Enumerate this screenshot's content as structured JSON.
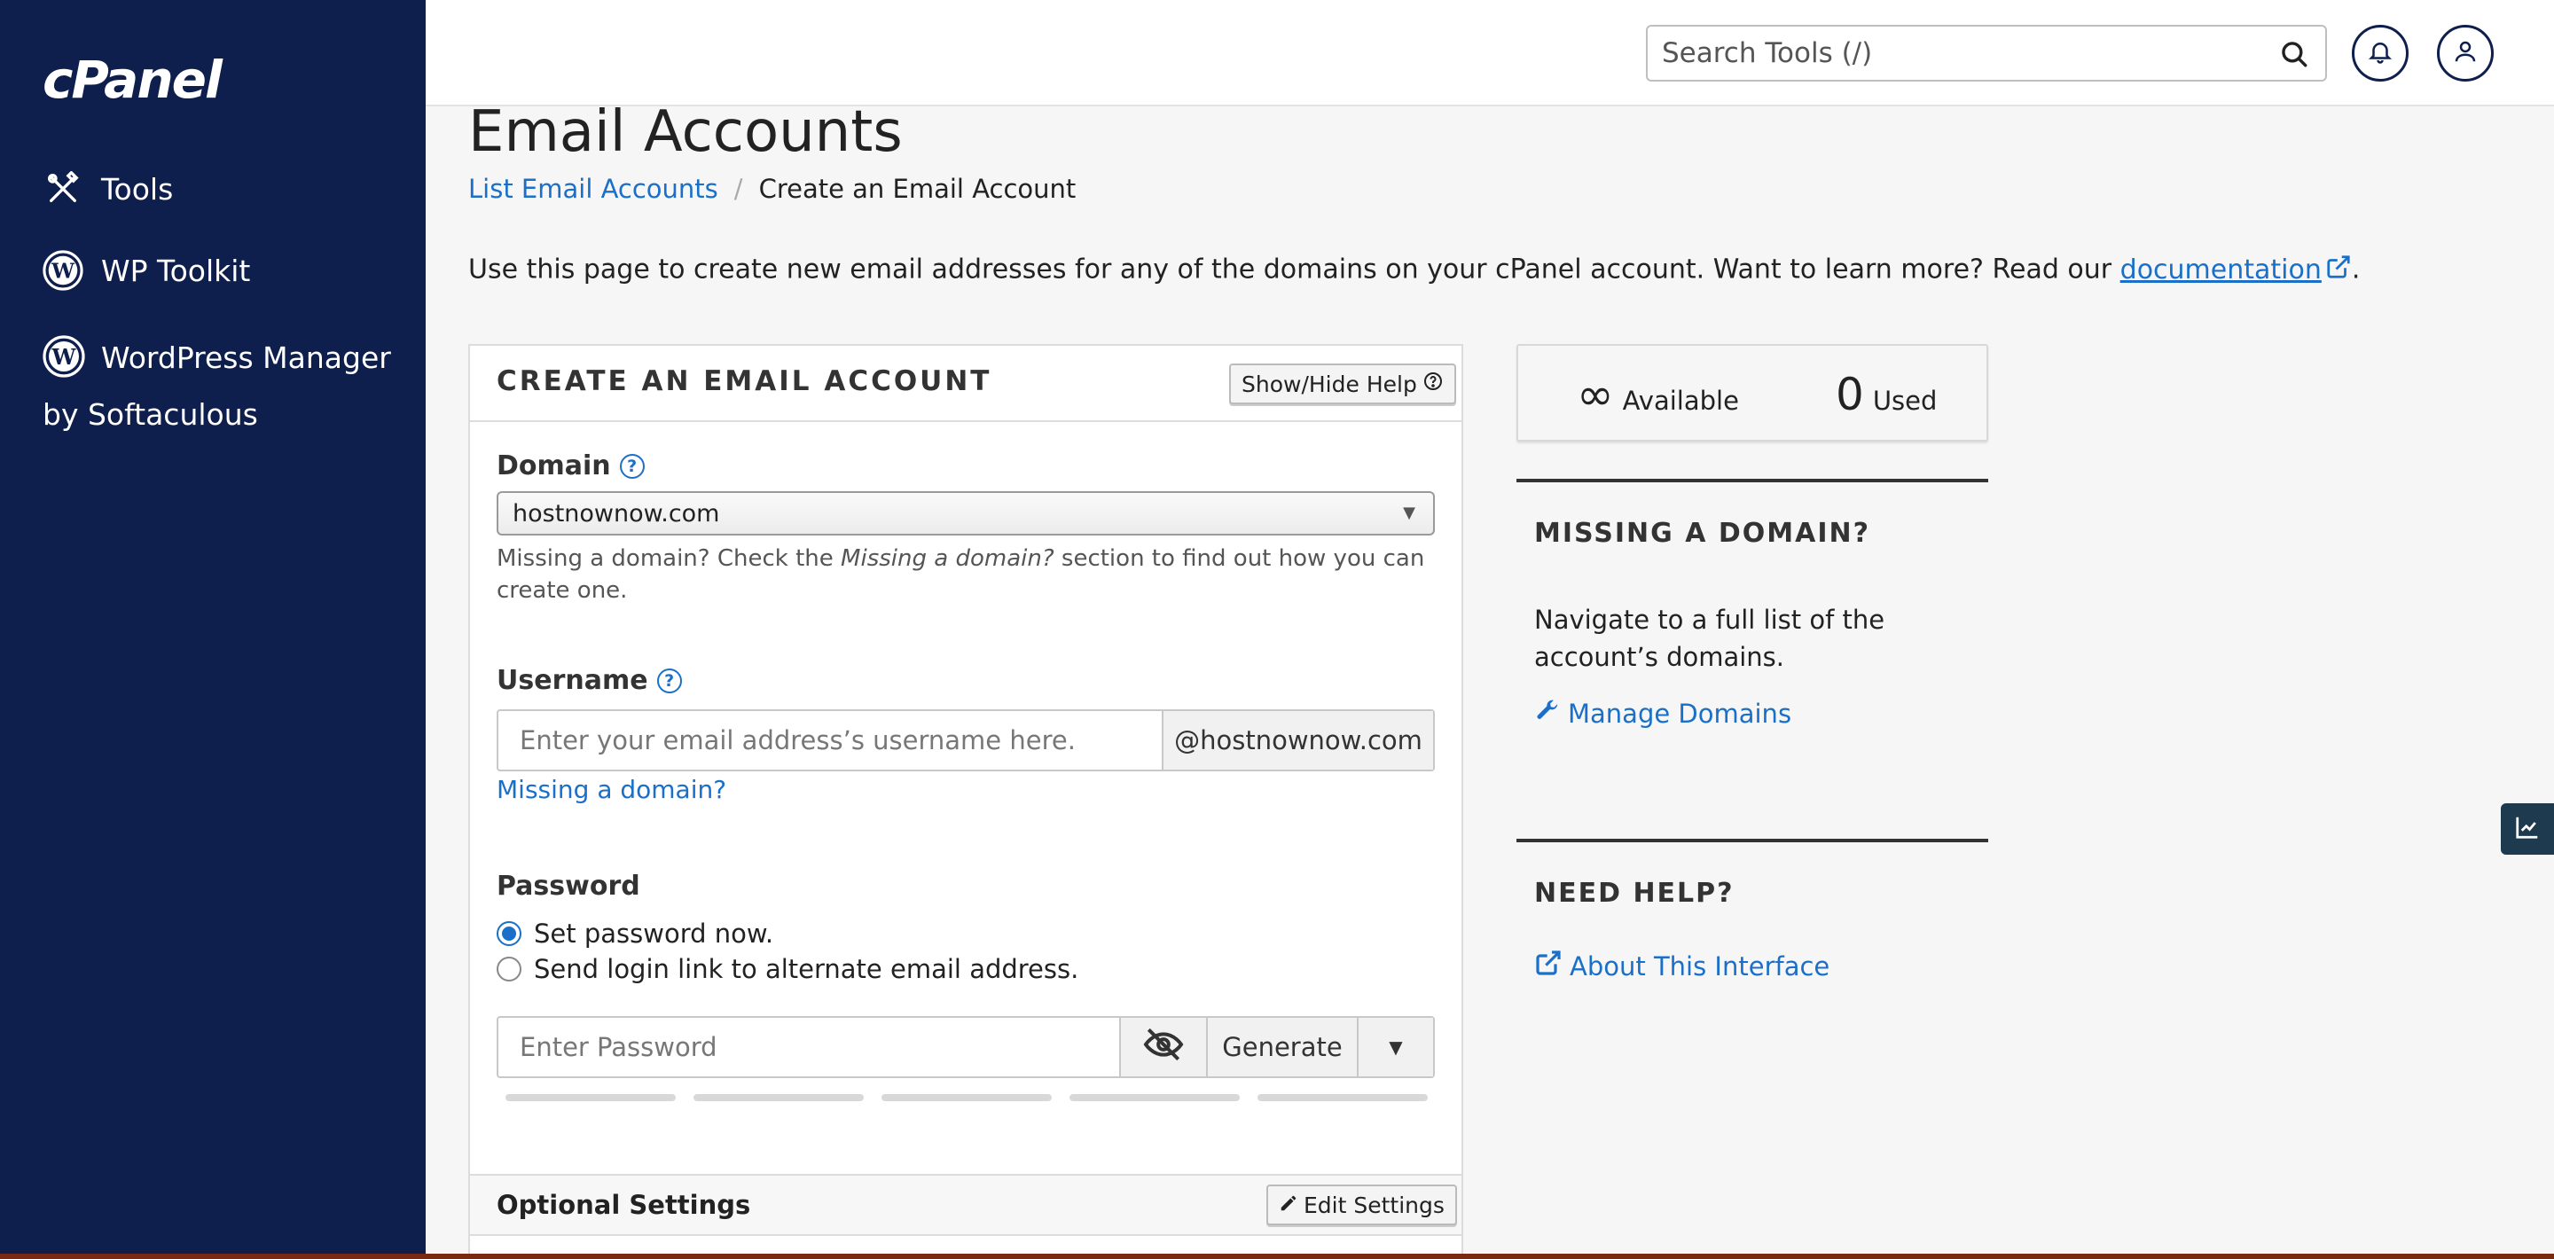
{
  "sidebar": {
    "logo": "cPanel",
    "items": [
      {
        "label": "Tools",
        "icon": "tools-icon"
      },
      {
        "label": "WP Toolkit",
        "icon": "wordpress-icon"
      },
      {
        "label": "WordPress Manager by Softaculous",
        "icon": "wordpress-icon"
      }
    ]
  },
  "header": {
    "search_placeholder": "Search Tools (/)",
    "notifications_icon": "bell-icon",
    "user_icon": "user-icon"
  },
  "page": {
    "title": "Email Accounts",
    "breadcrumb": [
      "List Email Accounts",
      "Create an Email Account"
    ],
    "intro_text": "Use this page to create new email addresses for any of the domains on your cPanel account. Want to learn more? Read our ",
    "intro_link": "documentation",
    "intro_end": "."
  },
  "create_card": {
    "title": "CREATE AN EMAIL ACCOUNT",
    "help_button": "Show/Hide Help",
    "domain_label": "Domain",
    "domain_value": "hostnownow.com",
    "domain_hint_pre": "Missing a domain? Check the ",
    "domain_hint_em": "Missing a domain?",
    "domain_hint_post": " section to find out how you can create one.",
    "username_label": "Username",
    "username_placeholder": "Enter your email address’s username here.",
    "username_suffix": "@hostnownow.com",
    "missing_domain_link": "Missing a domain?",
    "password_label": "Password",
    "password_options": [
      "Set password now.",
      "Send login link to alternate email address."
    ],
    "password_placeholder": "Enter Password",
    "generate_label": "Generate",
    "optional_settings": "Optional Settings",
    "edit_settings": "Edit Settings"
  },
  "stats": {
    "available_value": "∞",
    "available_label": "Available",
    "used_value": "0",
    "used_label": "Used"
  },
  "missing_domain": {
    "title": "MISSING A DOMAIN?",
    "text": "Navigate to a full list of the account’s domains.",
    "link": "Manage Domains"
  },
  "need_help": {
    "title": "NEED HELP?",
    "link": "About This Interface"
  },
  "colors": {
    "sidebar_bg": "#0e1f4d",
    "link": "#1a70c9",
    "radio_selected": "#1a70c9"
  }
}
